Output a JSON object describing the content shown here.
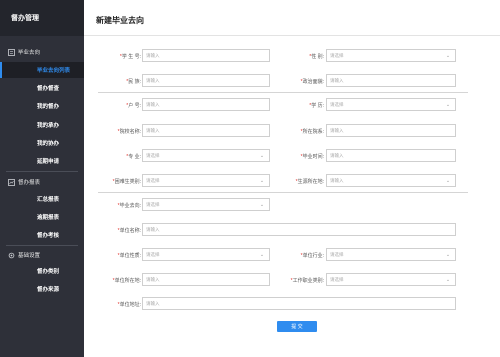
{
  "app": {
    "title": "督办管理"
  },
  "sidebar": {
    "sections": [
      {
        "icon": "list-icon",
        "label": "毕业去向"
      },
      {
        "icon": "report-icon",
        "label": "督办报表"
      },
      {
        "icon": "gear-icon",
        "label": "基础设置"
      }
    ],
    "items": [
      {
        "label": "毕业去向列表",
        "active": true
      },
      {
        "label": "督办督查"
      },
      {
        "label": "我的督办"
      },
      {
        "label": "我的承办"
      },
      {
        "label": "我的协办"
      },
      {
        "label": "延期申请"
      },
      {
        "label": "汇总报表"
      },
      {
        "label": "逾期报表"
      },
      {
        "label": "督办考核"
      },
      {
        "label": "督办类别"
      },
      {
        "label": "督办来源"
      }
    ]
  },
  "page": {
    "title": "新建毕业去向"
  },
  "form": {
    "placeholder_input": "请输入",
    "placeholder_select": "请选择",
    "fields": {
      "student_id": "学 生 号:",
      "gender": "性 别:",
      "ethnicity": "民 族:",
      "political_status": "政治面貌:",
      "household_type": "户 号:",
      "education": "学 历:",
      "school_name": "院校名称:",
      "faculty": "所在院系:",
      "major": "专 业:",
      "graduation_date": "毕业时间:",
      "difficulty_category": "困难生类别:",
      "origin_location": "生源所在地:",
      "destination": "毕业去向:",
      "employer_name": "单位名称:",
      "employer_nature": "单位性质:",
      "employer_industry": "单位行业:",
      "employer_location": "单位所在地:",
      "job_category": "工作职业类别:",
      "employer_address": "单位地址:"
    }
  },
  "actions": {
    "submit_label": "提 交"
  }
}
